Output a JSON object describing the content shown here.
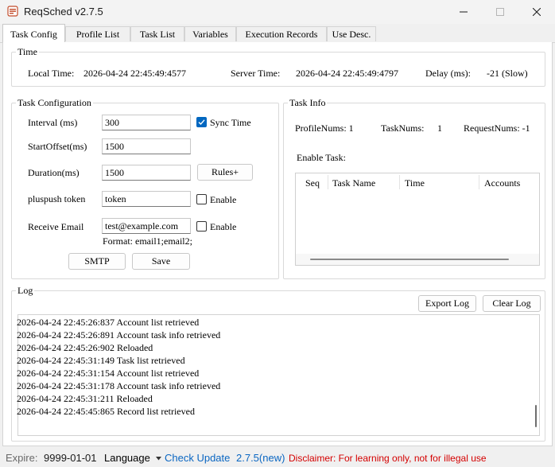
{
  "window": {
    "title": "ReqSched v2.7.5"
  },
  "tabs": [
    "Task Config",
    "Profile List",
    "Task List",
    "Variables",
    "Execution Records",
    "Use Desc."
  ],
  "time_group": {
    "legend": "Time",
    "local_label": "Local Time:",
    "local_value": "2026-04-24 22:45:49:4577",
    "server_label": "Server Time:",
    "server_value": "2026-04-24 22:45:49:4797",
    "delay_label": "Delay (ms):",
    "delay_value": "-21 (Slow)"
  },
  "task_config": {
    "legend": "Task Configuration",
    "interval_label": "Interval (ms)",
    "interval_value": "300",
    "sync_label": "Sync Time",
    "start_offset_label": "StartOffset(ms)",
    "start_offset_value": "1500",
    "duration_label": "Duration(ms)",
    "duration_value": "1500",
    "rules_button": "Rules+",
    "pluspush_label": "pluspush token",
    "pluspush_value": "token",
    "pluspush_enable": "Enable",
    "email_label": "Receive Email",
    "email_value": "test@example.com",
    "email_enable": "Enable",
    "email_format": "Format: email1;email2;",
    "smtp_button": "SMTP",
    "save_button": "Save"
  },
  "task_info": {
    "legend": "Task Info",
    "profile_nums": "ProfileNums: 1",
    "task_nums_label": "TaskNums:",
    "task_nums_value": "1",
    "request_nums": "RequestNums: -1",
    "enable_task_label": "Enable Task:",
    "columns": [
      "Seq",
      "Task Name",
      "Time",
      "Accounts"
    ]
  },
  "log": {
    "legend": "Log",
    "export_button": "Export Log",
    "clear_button": "Clear Log",
    "lines": [
      "2026-04-24 22:45:26:837 Account list retrieved",
      "2026-04-24 22:45:26:891 Account task info retrieved",
      "2026-04-24 22:45:26:902 Reloaded",
      "2026-04-24 22:45:31:149 Task list retrieved",
      "2026-04-24 22:45:31:154 Account list retrieved",
      "2026-04-24 22:45:31:178 Account task info retrieved",
      "2026-04-24 22:45:31:211 Reloaded",
      "2026-04-24 22:45:45:865 Record list retrieved"
    ]
  },
  "status": {
    "expire_label": "Expire:",
    "expire_value": "9999-01-01",
    "language": "Language",
    "check_update": "Check Update",
    "version": "2.7.5(new)",
    "disclaimer": "Disclaimer: For learning only, not for illegal use"
  },
  "colors": {
    "accent": "#0067c0",
    "link": "#0a66c2",
    "disclaimer": "#d40000"
  },
  "icons": [
    "app-icon",
    "minimize-icon",
    "maximize-icon",
    "close-icon",
    "check-icon",
    "caret-down-icon"
  ]
}
